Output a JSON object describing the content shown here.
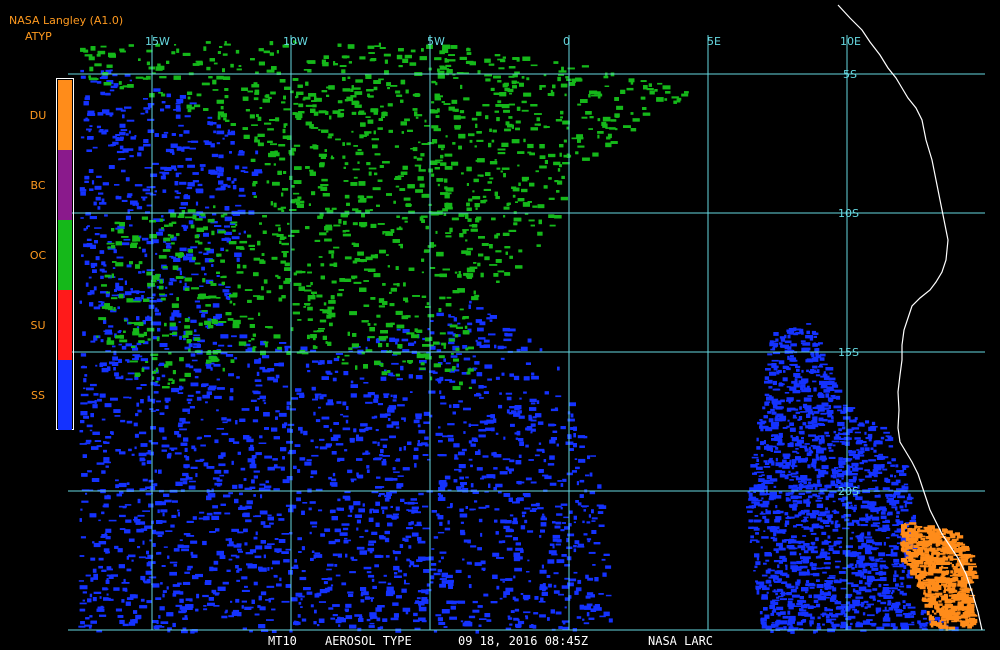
{
  "header": {
    "title": "NASA Langley (A1.0)",
    "product": "ATYP"
  },
  "legend": {
    "items": [
      {
        "code": "DU",
        "color": "#ff8c1a"
      },
      {
        "code": "BC",
        "color": "#8a1a8c"
      },
      {
        "code": "OC",
        "color": "#15b81a"
      },
      {
        "code": "SU",
        "color": "#ff1a1a"
      },
      {
        "code": "SS",
        "color": "#1432ff"
      }
    ]
  },
  "grid": {
    "color": "#66d8e0",
    "longitude_labels": [
      "15W",
      "10W",
      "5W",
      "0",
      "5E",
      "10E"
    ],
    "latitude_labels": [
      "5S",
      "10S",
      "15S",
      "20S"
    ]
  },
  "colors": {
    "background": "#000000",
    "coastline": "#ffffff",
    "ocean_clean": "#000000"
  },
  "footer": {
    "satellite": "MT10",
    "product_name": "AEROSOL TYPE",
    "datetime": "09 18, 2016 08:45Z",
    "source": "NASA LARC"
  }
}
